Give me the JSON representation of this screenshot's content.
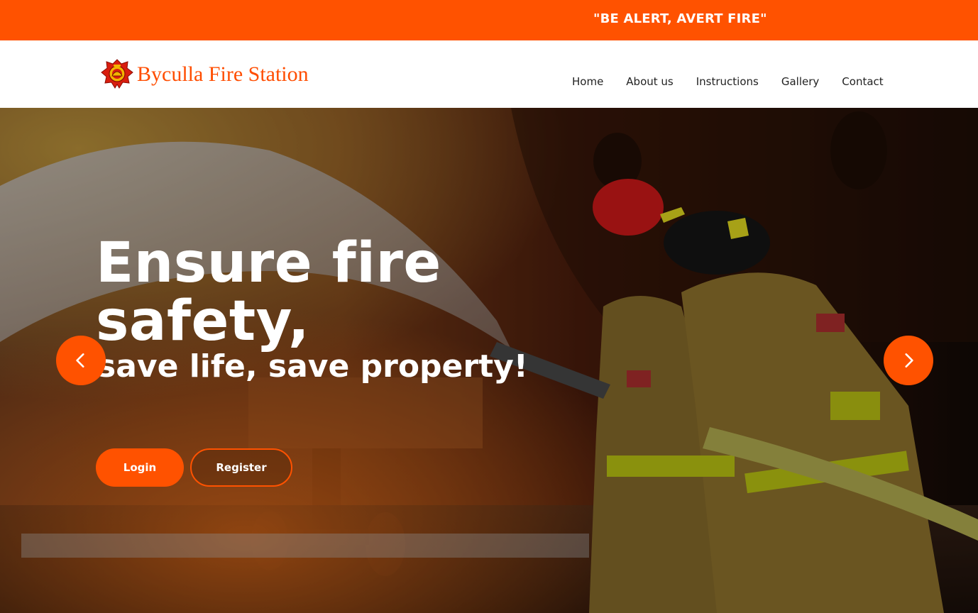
{
  "topbar": {
    "slogan": "\"BE ALERT, AVERT FIRE\"",
    "bg_color": "#ff5200"
  },
  "header": {
    "brand_name": "Byculla Fire Station",
    "logo_icon": "fire-department-badge-icon",
    "nav": [
      {
        "label": "Home"
      },
      {
        "label": "About us"
      },
      {
        "label": "Instructions"
      },
      {
        "label": "Gallery"
      },
      {
        "label": "Contact"
      }
    ]
  },
  "hero": {
    "title_line1": "Ensure fire",
    "title_line2": "safety,",
    "subtitle": "save life, save property!",
    "login_label": "Login",
    "register_label": "Register",
    "prev_icon": "chevron-left-icon",
    "next_icon": "chevron-right-icon",
    "accent_color": "#ff5200",
    "background_image": "firefighters spraying water hose at fire"
  }
}
